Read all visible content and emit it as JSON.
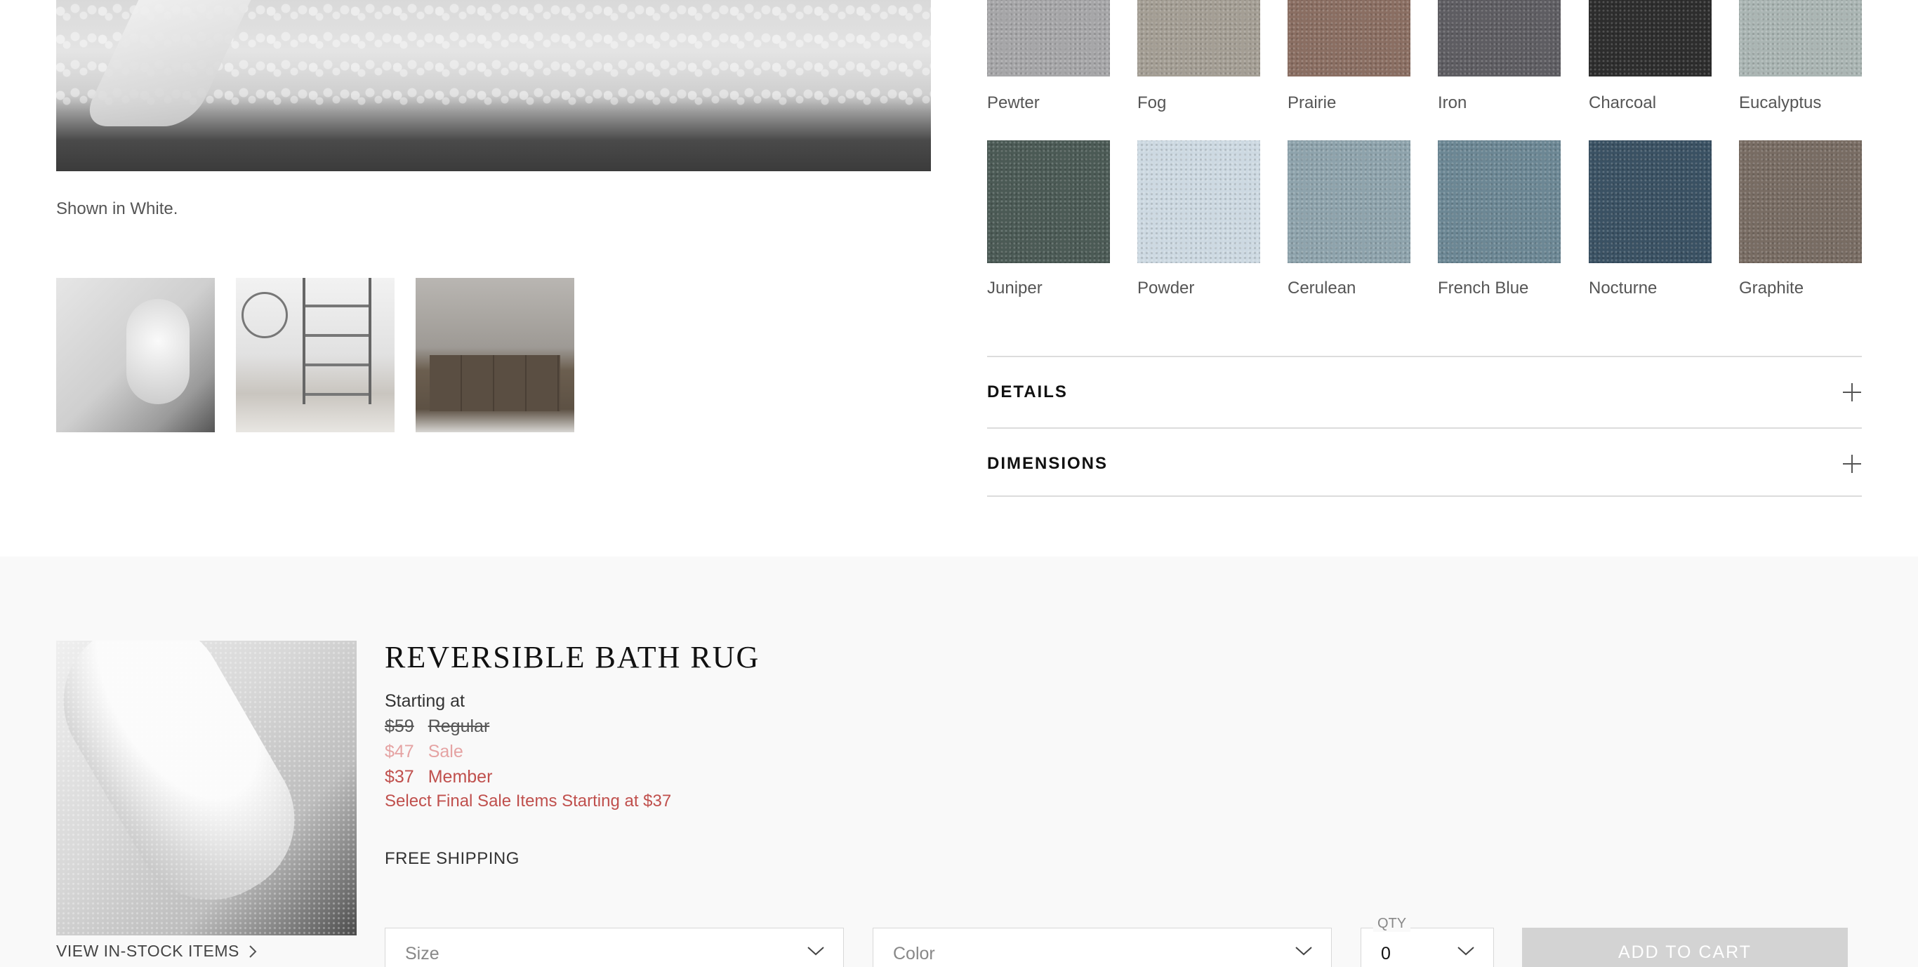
{
  "gallery": {
    "caption": "Shown in White.",
    "zoom_icon": "plus-icon",
    "thumbnails": [
      "rolled-rug-thumbnail",
      "bathroom-shelving-thumbnail",
      "bathroom-vanity-thumbnail"
    ]
  },
  "swatches": [
    {
      "name": "Pewter",
      "color": "#a6a6a8"
    },
    {
      "name": "Fog",
      "color": "#a49e94"
    },
    {
      "name": "Prairie",
      "color": "#8a6e62"
    },
    {
      "name": "Iron",
      "color": "#5e5d62"
    },
    {
      "name": "Charcoal",
      "color": "#2d2d2d"
    },
    {
      "name": "Eucalyptus",
      "color": "#aab5b3"
    },
    {
      "name": "Juniper",
      "color": "#4b5a55"
    },
    {
      "name": "Powder",
      "color": "#cdd9e2"
    },
    {
      "name": "Cerulean",
      "color": "#8ea3ac"
    },
    {
      "name": "French Blue",
      "color": "#6c8794"
    },
    {
      "name": "Nocturne",
      "color": "#3a5163"
    },
    {
      "name": "Graphite",
      "color": "#786c63"
    }
  ],
  "accordions": {
    "details": "DETAILS",
    "dimensions": "DIMENSIONS"
  },
  "product": {
    "title": "REVERSIBLE BATH RUG",
    "starting_at": "Starting at",
    "regular_price": "$59",
    "regular_label": "Regular",
    "sale_price": "$47",
    "sale_label": "Sale",
    "member_price": "$37",
    "member_label": "Member",
    "final_sale": "Select Final Sale Items Starting at $37",
    "shipping": "FREE SHIPPING",
    "view_instock": "VIEW IN-STOCK ITEMS"
  },
  "form": {
    "size_placeholder": "Size",
    "color_placeholder": "Color",
    "qty_label": "QTY",
    "qty_value": "0",
    "add_to_cart": "ADD TO CART"
  },
  "colors": {
    "member_red": "#c0504d",
    "sale_pink": "#e5a3a3",
    "disabled_button": "#d3d3d3"
  }
}
